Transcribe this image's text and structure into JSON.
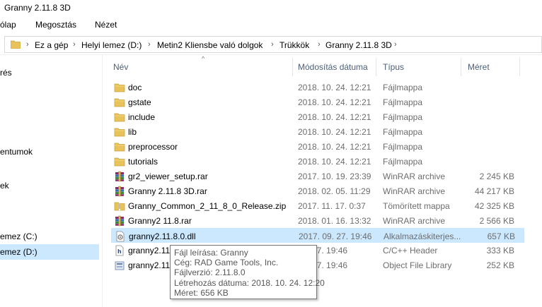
{
  "window": {
    "title": "Granny 2.11.8 3D"
  },
  "ribbon": {
    "tabs": [
      "ólap",
      "Megosztás",
      "Nézet"
    ]
  },
  "address": {
    "crumbs": [
      "Ez a gép",
      "Helyi lemez (D:)",
      "Metin2 Kliensbe való dolgok",
      "Trükkök",
      "Granny 2.11.8 3D"
    ]
  },
  "nav": {
    "items": [
      "rés",
      "entumok",
      "ek",
      "emez (C:)",
      "emez (D:)"
    ]
  },
  "columns": {
    "name": "Név",
    "date": "Módosítás dátuma",
    "type": "Típus",
    "size": "Méret"
  },
  "files": [
    {
      "name": "doc",
      "date": "2018. 10. 24. 12:21",
      "type": "Fájlmappa",
      "size": "",
      "icon": "folder-icon"
    },
    {
      "name": "gstate",
      "date": "2018. 10. 24. 12:21",
      "type": "Fájlmappa",
      "size": "",
      "icon": "folder-icon"
    },
    {
      "name": "include",
      "date": "2018. 10. 24. 12:21",
      "type": "Fájlmappa",
      "size": "",
      "icon": "folder-icon"
    },
    {
      "name": "lib",
      "date": "2018. 10. 24. 12:21",
      "type": "Fájlmappa",
      "size": "",
      "icon": "folder-icon"
    },
    {
      "name": "preprocessor",
      "date": "2018. 10. 24. 12:21",
      "type": "Fájlmappa",
      "size": "",
      "icon": "folder-icon"
    },
    {
      "name": "tutorials",
      "date": "2018. 10. 24. 12:21",
      "type": "Fájlmappa",
      "size": "",
      "icon": "folder-icon"
    },
    {
      "name": "gr2_viewer_setup.rar",
      "date": "2017. 10. 19. 23:39",
      "type": "WinRAR archive",
      "size": "2 245 KB",
      "icon": "rar-archive-icon"
    },
    {
      "name": "Granny 2.11.8 3D.rar",
      "date": "2018. 02. 05. 11:29",
      "type": "WinRAR archive",
      "size": "44 217 KB",
      "icon": "rar-archive-icon"
    },
    {
      "name": "Granny_Common_2_11_8_0_Release.zip",
      "date": "2017. 11. 17. 0:37",
      "type": "Tömörített mappa",
      "size": "42 325 KB",
      "icon": "zip-folder-icon"
    },
    {
      "name": "Granny2 11.8.rar",
      "date": "2018. 01. 16. 13:32",
      "type": "WinRAR archive",
      "size": "2 566 KB",
      "icon": "rar-archive-icon"
    },
    {
      "name": "granny2.11.8.0.dll",
      "date": "2017. 09. 27. 19:46",
      "type": "Alkalmazáskiterjes...",
      "size": "657 KB",
      "icon": "dll-file-icon"
    },
    {
      "name": "granny2.11",
      "date": "09. 27. 19:46",
      "type": "C/C++ Header",
      "size": "333 KB",
      "icon": "header-file-icon"
    },
    {
      "name": "granny2.11",
      "date": "09. 27. 19:46",
      "type": "Object File Library",
      "size": "252 KB",
      "icon": "library-file-icon"
    }
  ],
  "tooltip": {
    "lines": [
      "Fájl leírása: Granny",
      "Cég: RAD Game Tools, Inc.",
      "Fájlverzió: 2.11.8.0",
      "Létrehozás dátuma: 2018. 10. 24. 12:20",
      "Méret: 656 KB"
    ]
  },
  "colors": {
    "selection": "#cce8ff",
    "folder": "#e8c25a",
    "header_text": "#4c607a"
  }
}
